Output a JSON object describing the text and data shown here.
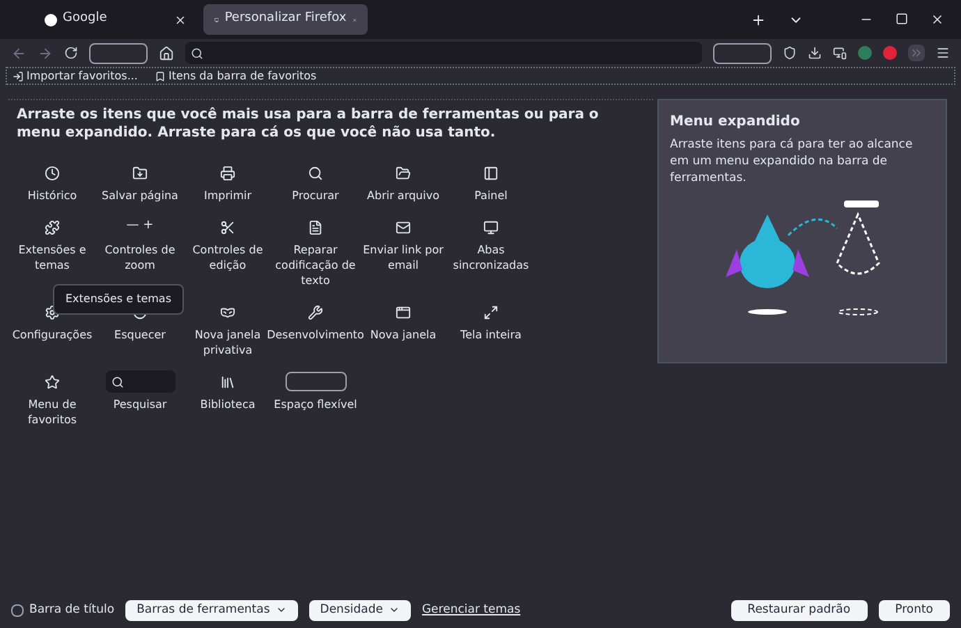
{
  "tabs": [
    {
      "label": "Google",
      "selected": false,
      "kind": "google"
    },
    {
      "label": "Personalizar Firefox",
      "selected": true,
      "kind": "custom"
    }
  ],
  "bookmarks": [
    {
      "label": "Importar favoritos..."
    },
    {
      "label": "Itens da barra de favoritos"
    }
  ],
  "heading": "Arraste os itens que você mais usa para a barra de ferramentas ou para o menu expandido. Arraste para cá os que você não usa tanto.",
  "items": [
    {
      "label": "Histórico",
      "kind": "button"
    },
    {
      "label": "Salvar página",
      "kind": "button"
    },
    {
      "label": "Imprimir",
      "kind": "button"
    },
    {
      "label": "Procurar",
      "kind": "button"
    },
    {
      "label": "Abrir arquivo",
      "kind": "button"
    },
    {
      "label": "Painel",
      "kind": "button"
    },
    {
      "label": "Extensões e temas",
      "kind": "button"
    },
    {
      "label": "Controles de zoom",
      "kind": "zoom",
      "icon_text": "— +"
    },
    {
      "label": "Controles de edição",
      "kind": "button"
    },
    {
      "label": "Reparar codificação de texto",
      "kind": "button"
    },
    {
      "label": "Enviar link por email",
      "kind": "button"
    },
    {
      "label": "Abas sincronizadas",
      "kind": "button"
    },
    {
      "label": "Configurações",
      "kind": "button"
    },
    {
      "label": "Esquecer",
      "kind": "button"
    },
    {
      "label": "Nova janela privativa",
      "kind": "button"
    },
    {
      "label": "Desenvolvimento",
      "kind": "button"
    },
    {
      "label": "Nova janela",
      "kind": "button"
    },
    {
      "label": "Tela inteira",
      "kind": "button"
    },
    {
      "label": "Menu de favoritos",
      "kind": "button"
    },
    {
      "label": "Pesquisar",
      "kind": "search"
    },
    {
      "label": "Biblioteca",
      "kind": "button"
    },
    {
      "label": "Espaço flexível",
      "kind": "spacer"
    }
  ],
  "tooltip": "Extensões e temas",
  "panel": {
    "title": "Menu expandido",
    "text": "Arraste itens para cá para ter ao alcance em um menu expandido na barra de ferramentas."
  },
  "footer": {
    "title_bar": {
      "label": "Barra de título",
      "checked": false
    },
    "dropdowns": [
      "Barras de ferramentas",
      "Densidade"
    ],
    "link": "Gerenciar temas",
    "buttons": [
      "Restaurar padrão",
      "Pronto"
    ]
  }
}
